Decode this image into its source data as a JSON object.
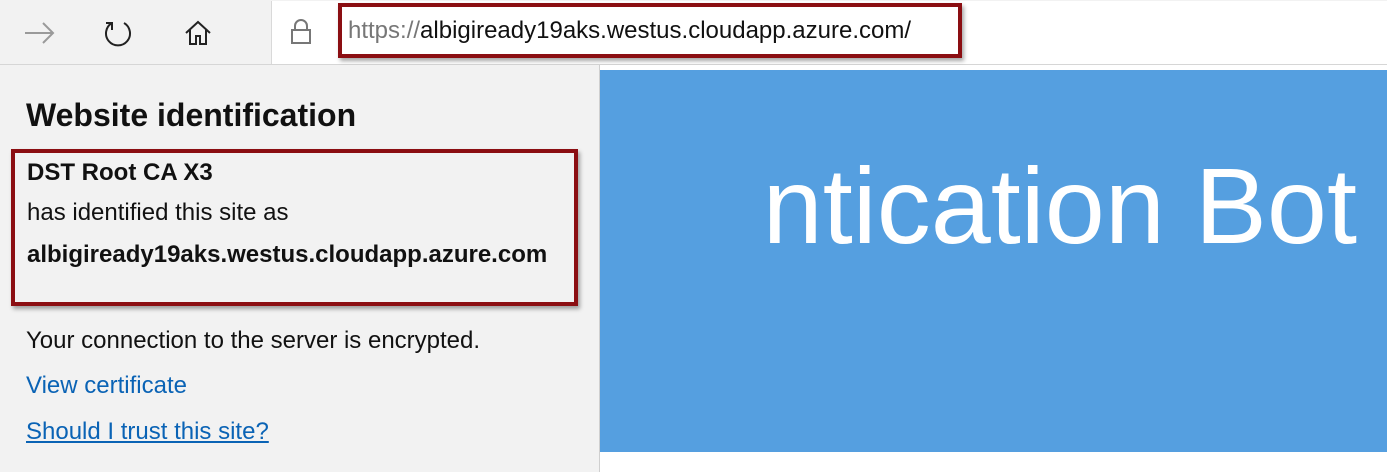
{
  "toolbar": {
    "forward_icon": "forward-arrow-icon",
    "refresh_icon": "refresh-icon",
    "home_icon": "home-icon",
    "lock_icon": "lock-icon",
    "address": {
      "scheme": "https://",
      "host": "albigiready19aks.westus.cloudapp.azure.com/"
    }
  },
  "panel": {
    "title": "Website identification",
    "ca_name": "DST Root CA X3",
    "identified_text": "has identified this site as",
    "identified_host": "albigiready19aks.westus.cloudapp.azure.com",
    "connection_text": "Your connection to the server is encrypted.",
    "view_certificate": "View certificate",
    "trust_link": "Should I trust this site?"
  },
  "page": {
    "banner_text": "ntication Bot"
  },
  "colors": {
    "highlight_border": "#8b0e12",
    "banner_bg": "#559fe0",
    "link": "#0a63b5",
    "panel_bg": "#f2f2f2"
  }
}
